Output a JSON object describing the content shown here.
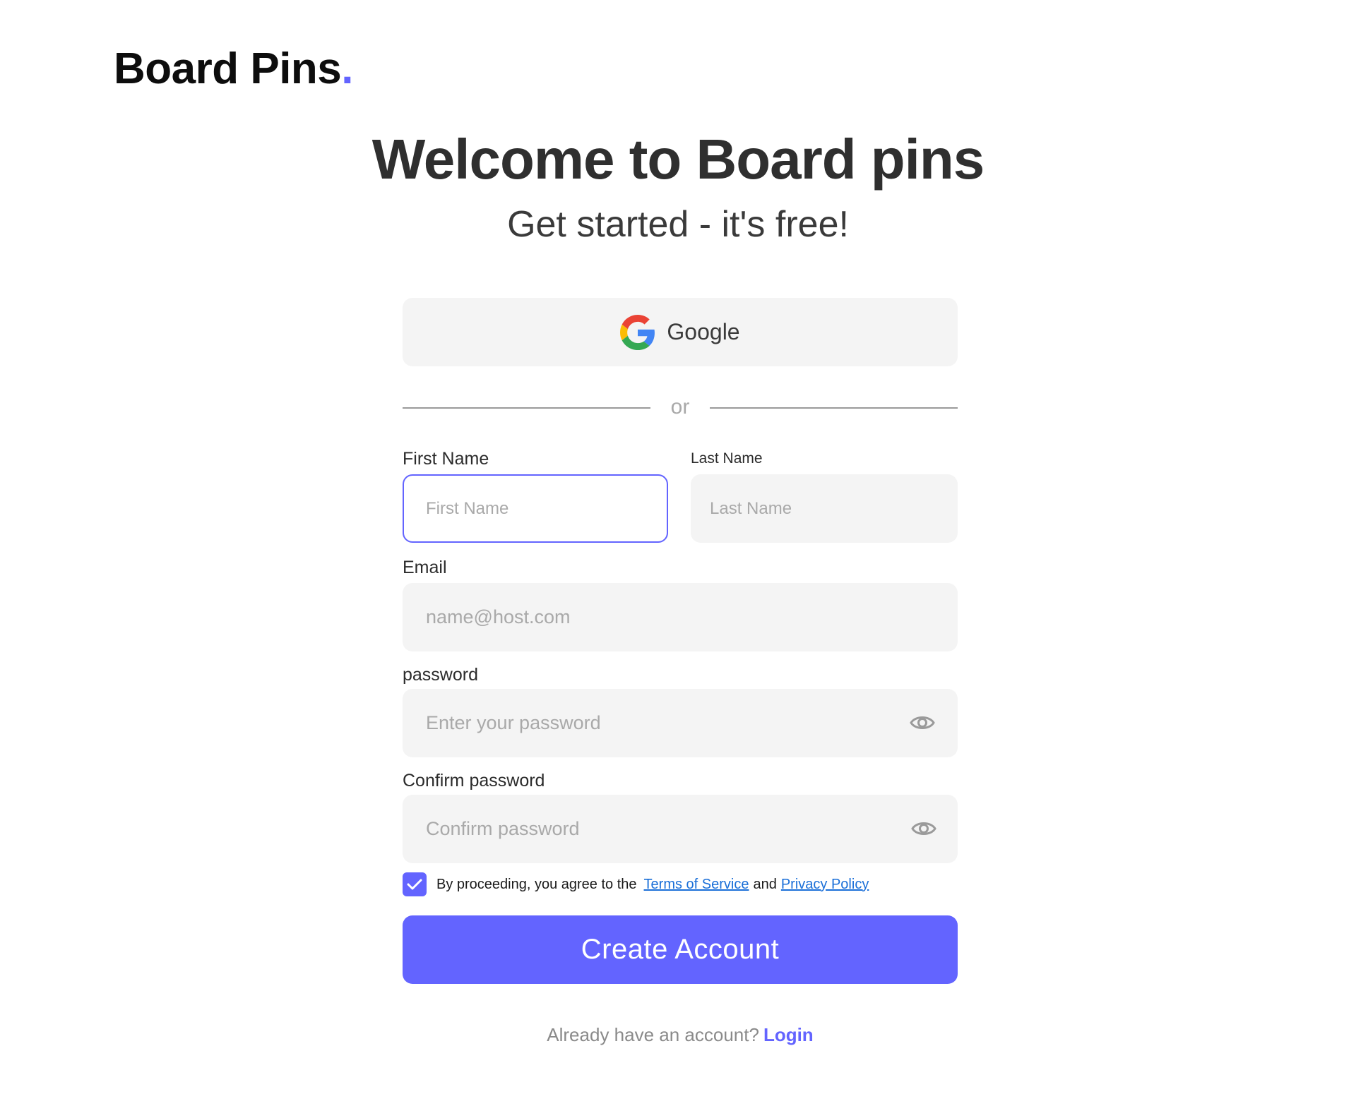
{
  "brand": {
    "name": "Board Pins",
    "dot": ".",
    "accent_color": "#6364ff"
  },
  "hero": {
    "title": "Welcome to Board pins",
    "subtitle": "Get started - it's free!"
  },
  "social": {
    "google_label": "Google",
    "icon": "google-icon"
  },
  "divider_text": "or",
  "fields": {
    "first_name": {
      "label": "First Name",
      "placeholder": "First Name",
      "value": ""
    },
    "last_name": {
      "label": "Last Name",
      "placeholder": "Last Name",
      "value": ""
    },
    "email": {
      "label": "Email",
      "placeholder": "name@host.com",
      "value": ""
    },
    "password": {
      "label": "password",
      "placeholder": "Enter your password",
      "value": "",
      "icon": "eye-icon"
    },
    "confirm_password": {
      "label": "Confirm password",
      "placeholder": "Confirm password",
      "value": "",
      "icon": "eye-icon"
    }
  },
  "agreement": {
    "checked": true,
    "text": "By proceeding, you agree to the",
    "terms_label": "Terms of Service",
    "and_text": "and",
    "privacy_label": "Privacy Policy",
    "link_color": "#1a6fd8"
  },
  "submit_label": "Create Account",
  "login_prompt": {
    "text": "Already have an account?",
    "link_label": "Login"
  }
}
